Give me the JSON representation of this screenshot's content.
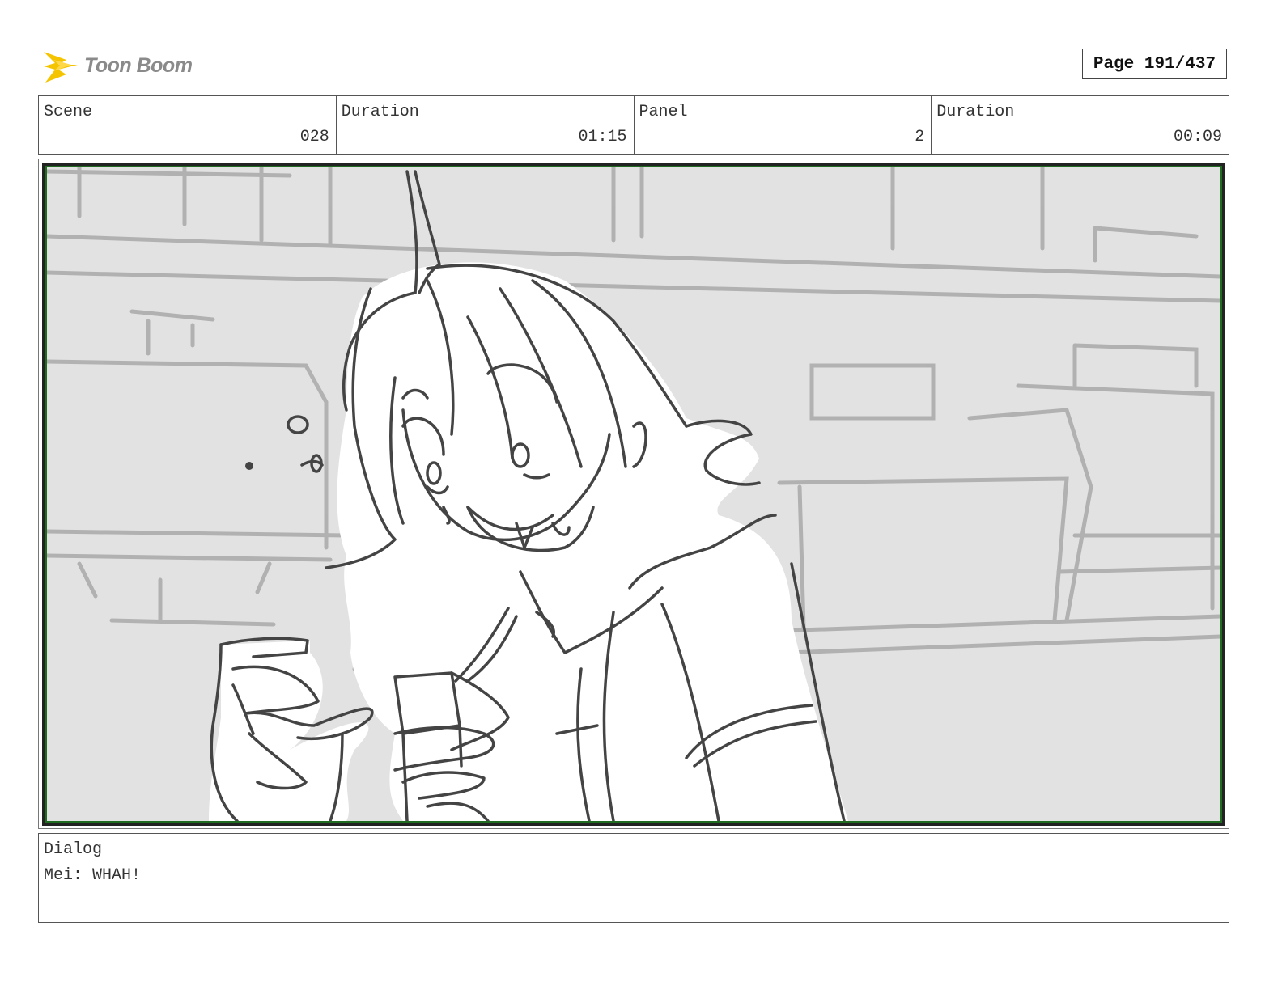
{
  "header": {
    "logo_text": "Toon Boom",
    "page_label": "Page 191/437"
  },
  "info": {
    "scene": {
      "label": "Scene",
      "value": "028"
    },
    "scene_duration": {
      "label": "Duration",
      "value": "01:15"
    },
    "panel": {
      "label": "Panel",
      "value": "2"
    },
    "panel_duration": {
      "label": "Duration",
      "value": "00:09"
    }
  },
  "dialog": {
    "label": "Dialog",
    "text": "Mei: WHAH!"
  },
  "colors": {
    "logo_yellow": "#f5c400",
    "panel_border_green": "#1f6b1f",
    "sketch_line": "#444444",
    "background_gray": "#e2e2e2"
  }
}
